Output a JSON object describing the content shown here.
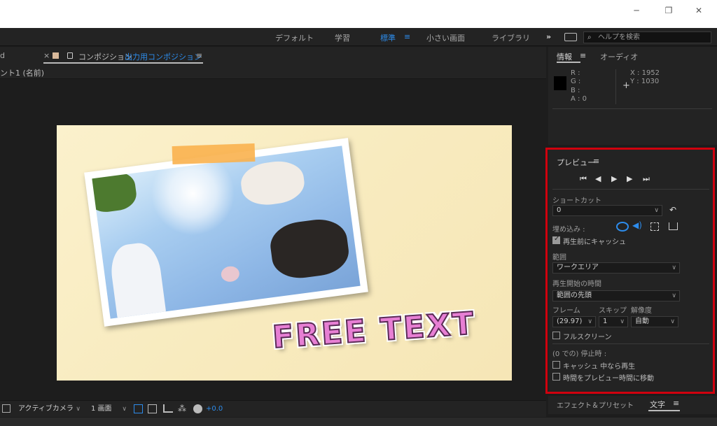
{
  "window": {
    "minimize": "─",
    "restore": "❐",
    "close": "✕"
  },
  "workspaces": {
    "items": [
      "デフォルト",
      "学習",
      "標準",
      "小さい画面",
      "ライブラリ"
    ],
    "active_index": 2,
    "menu_glyph": "≡",
    "overflow": "»",
    "search_placeholder": "ヘルプを検索"
  },
  "comp": {
    "left_tab_fragment": "d",
    "close_glyph": "×",
    "lock_glyph": "🔒",
    "tab_prefix": "コンポジション",
    "tab_name": "出力用コンポジション",
    "menu_glyph": "≡",
    "breadcrumb": "ント1 (名前)",
    "free_text": "FREE TEXT"
  },
  "comp_bottom": {
    "view": "アクティブカメラ",
    "layout": "1 画面",
    "exposure": "+0.0"
  },
  "info": {
    "title": "情報",
    "menu_glyph": "≡",
    "audio_tab": "オーディオ",
    "r_label": "R :",
    "g_label": "G :",
    "b_label": "B :",
    "a_label": "A : 0",
    "x_label": "X : 1952",
    "y_label": "Y : 1030",
    "swatch_color": "#000000"
  },
  "preview": {
    "title": "プレビュー",
    "menu_glyph": "≡",
    "shortcut_label": "ショートカット",
    "shortcut_value": "0",
    "embed_label": "埋め込み :",
    "cache_before_play": "再生前にキャッシュ",
    "range_label": "範囲",
    "range_value": "ワークエリア",
    "start_label": "再生開始の時間",
    "start_value": "範囲の先頭",
    "frame_label": "フレーム",
    "skip_label": "スキップ",
    "res_label": "解像度",
    "frame_value": "(29.97)",
    "skip_value": "1",
    "res_value": "自動",
    "fullscreen": "フルスクリーン",
    "stop_label": "(0 での) 停止時 :",
    "play_if_cached": "キャッシュ 中なら再生",
    "move_time": "時間をプレビュー時間に移動",
    "accent": "#2d8ceb"
  },
  "effects": {
    "left_tab": "エフェクト＆プリセット",
    "right_tab": "文字",
    "menu_glyph": "≡"
  }
}
